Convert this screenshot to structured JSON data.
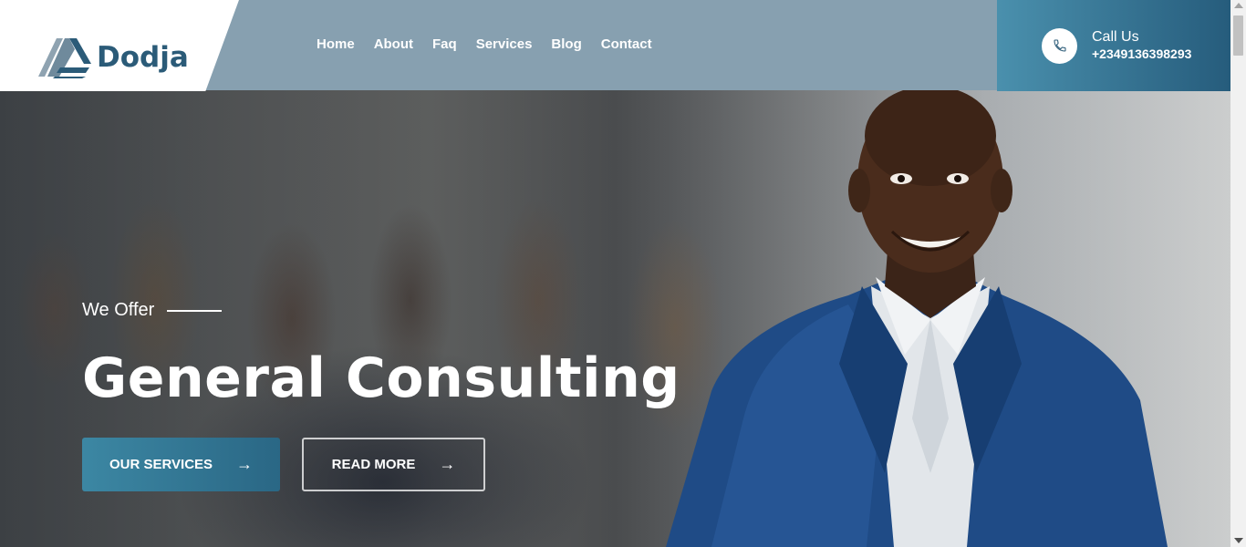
{
  "brand": {
    "name": "Dodja",
    "color": "#2b5b78"
  },
  "nav": {
    "items": [
      {
        "label": "Home"
      },
      {
        "label": "About"
      },
      {
        "label": "Faq"
      },
      {
        "label": "Services"
      },
      {
        "label": "Blog"
      },
      {
        "label": "Contact"
      }
    ]
  },
  "call": {
    "label": "Call Us",
    "number": "+2349136398293",
    "icon": "phone-icon"
  },
  "hero": {
    "tagline": "We Offer",
    "title": "General Consulting",
    "primary_button": "OUR SERVICES",
    "secondary_button": "READ MORE"
  },
  "colors": {
    "navbar": "#87a0b0",
    "accent_start": "#3c87a3",
    "accent_end": "#2a6785"
  }
}
